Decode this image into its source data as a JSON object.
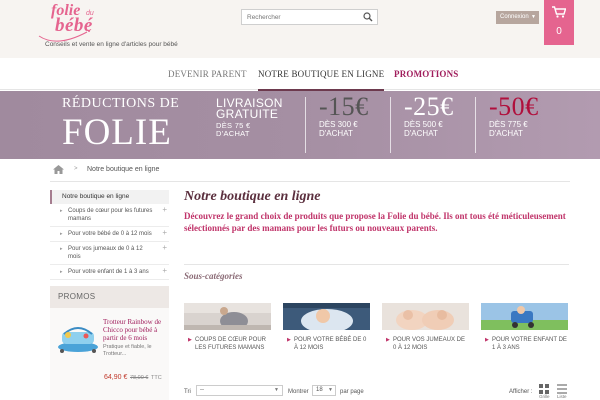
{
  "header": {
    "logo": {
      "folie": "folie",
      "du": "du",
      "bebe": "bébé"
    },
    "tagline": "Conseils et vente en ligne d'articles pour bébé",
    "search_placeholder": "Rechercher",
    "connexion_label": "Connexion",
    "cart_count": "0"
  },
  "nav": {
    "items": [
      {
        "label": "DEVENIR PARENT"
      },
      {
        "label": "NOTRE BOUTIQUE EN LIGNE"
      },
      {
        "label": "PROMOTIONS"
      }
    ]
  },
  "banner": {
    "line1": "RÉDUCTIONS DE",
    "line2": "FOLIE",
    "livraison": "LIVRAISON",
    "gratuite": "GRATUITE",
    "livraison_cond1": "DÈS 75 €",
    "livraison_cond2": "D'ACHAT",
    "offers": [
      {
        "pct": "-15€",
        "cond1": "DÈS 300 €",
        "cond2": "D'ACHAT"
      },
      {
        "pct": "-25€",
        "cond1": "DÈS 500 €",
        "cond2": "D'ACHAT"
      },
      {
        "pct": "-50€",
        "cond1": "DÈS 775 €",
        "cond2": "D'ACHAT"
      }
    ]
  },
  "breadcrumb": {
    "current": "Notre boutique en ligne"
  },
  "sidebar": {
    "title": "Notre boutique en ligne",
    "items": [
      {
        "label": "Coups de cœur pour les futures mamans"
      },
      {
        "label": "Pour votre bébé de 0 à 12 mois"
      },
      {
        "label": "Pour vos jumeaux de 0 à 12 mois"
      },
      {
        "label": "Pour votre enfant de 1 à 3 ans"
      }
    ]
  },
  "promos": {
    "title": "PROMOS",
    "product_name": "Trotteur Rainbow de Chicco pour bébé à partir de 6 mois",
    "product_desc": "Pratique et fiable, le Trotteur...",
    "price": "64,90 €",
    "old_price": "78,00 €",
    "ttc": "TTC"
  },
  "main": {
    "title": "Notre boutique en ligne",
    "description": "Découvrez le grand choix de produits que propose la Folie du bébé. Ils ont tous été méticuleusement sélectionnés par des mamans pour les futurs ou nouveaux parents.",
    "subcategories_title": "Sous-catégories",
    "subcategories": [
      {
        "label": "COUPS DE CŒUR POUR LES FUTURES MAMANS"
      },
      {
        "label": "POUR VOTRE BÉBÉ DE 0 À 12 MOIS"
      },
      {
        "label": "POUR VOS JUMEAUX DE 0 À 12 MOIS"
      },
      {
        "label": "POUR VOTRE ENFANT DE 1 À 3 ANS"
      }
    ]
  },
  "toolbar": {
    "sort_label": "Tri",
    "sort_value": "--",
    "show_label": "Montrer",
    "show_value": "18",
    "per_page": "par page",
    "display_label": "Afficher :",
    "grid_label": "Grille",
    "list_label": "Liste"
  },
  "colors": {
    "accent": "#e5648f",
    "brand_dark": "#5b2f3e",
    "promo": "#a01d5c",
    "banner": "#a58fa3"
  }
}
